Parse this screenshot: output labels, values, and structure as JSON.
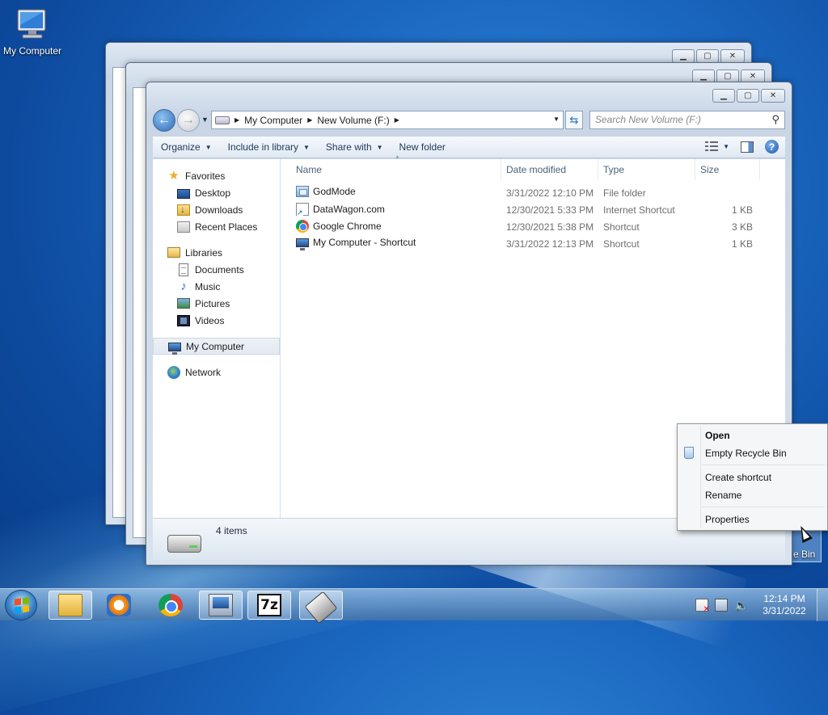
{
  "desktop": {
    "my_computer_label": "My Computer",
    "recycle_bin_partial": "e Bin"
  },
  "explorer": {
    "breadcrumb": [
      "My Computer",
      "New Volume (F:)"
    ],
    "search_placeholder": "Search New Volume (F:)",
    "toolbar": {
      "organize": "Organize",
      "include_in_library": "Include in library",
      "share_with": "Share with",
      "new_folder": "New folder"
    },
    "nav": {
      "favorites": "Favorites",
      "favorites_items": [
        "Desktop",
        "Downloads",
        "Recent Places"
      ],
      "libraries": "Libraries",
      "libraries_items": [
        "Documents",
        "Music",
        "Pictures",
        "Videos"
      ],
      "computer": "My Computer",
      "network": "Network"
    },
    "columns": {
      "name": "Name",
      "date": "Date modified",
      "type": "Type",
      "size": "Size"
    },
    "files": [
      {
        "name": "GodMode",
        "date": "3/31/2022 12:10 PM",
        "type": "File folder",
        "size": "",
        "icon": "folder-icon"
      },
      {
        "name": "DataWagon.com",
        "date": "12/30/2021 5:33 PM",
        "type": "Internet Shortcut",
        "size": "1 KB",
        "icon": "internet-shortcut-icon"
      },
      {
        "name": "Google Chrome",
        "date": "12/30/2021 5:38 PM",
        "type": "Shortcut",
        "size": "3 KB",
        "icon": "chrome-icon"
      },
      {
        "name": "My Computer - Shortcut",
        "date": "3/31/2022 12:13 PM",
        "type": "Shortcut",
        "size": "1 KB",
        "icon": "computer-shortcut-icon"
      }
    ],
    "status": "4 items"
  },
  "context_menu": {
    "open": "Open",
    "empty_recycle_bin": "Empty Recycle Bin",
    "create_shortcut": "Create shortcut",
    "rename": "Rename",
    "properties": "Properties"
  },
  "taskbar": {
    "time": "12:14 PM",
    "date": "3/31/2022"
  }
}
